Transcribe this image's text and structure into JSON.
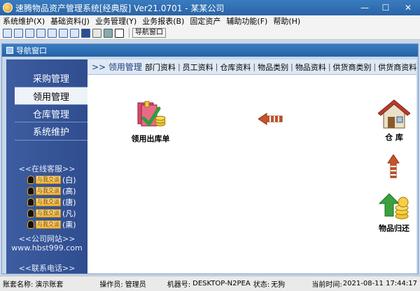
{
  "window": {
    "title": "速腾物品资产管理系统[经典版] Ver21.0701  -  某某公司",
    "minimize": "—",
    "maximize": "☐",
    "close": "✕"
  },
  "menu": [
    "系统维护(X)",
    "基础资料(J)",
    "业务管理(Y)",
    "业务报表(B)",
    "固定资产",
    "辅助功能(F)",
    "帮助(H)"
  ],
  "toolbar": {
    "icons": [
      "window-icon",
      "list-icon",
      "table-icon",
      "folder-open-icon",
      "tree-icon",
      "card-icon",
      "database-icon",
      "save-icon",
      "print-icon",
      "calculator-icon",
      "logout-icon"
    ],
    "nav_button": "导航窗口"
  },
  "nav_window": {
    "title": "导航窗口"
  },
  "sidebar": {
    "items": [
      "采购管理",
      "领用管理",
      "仓库管理",
      "系统维护"
    ],
    "active_index": 1,
    "online_service_label": "<<在线客服>>",
    "qq_contacts": [
      {
        "button": "与我交谈",
        "name": "(白)"
      },
      {
        "button": "与我交谈",
        "name": "(高)"
      },
      {
        "button": "与我交谈",
        "name": "(唐)"
      },
      {
        "button": "与我交谈",
        "name": "(凡)"
      },
      {
        "button": "与我交谈",
        "name": "(熏)"
      }
    ],
    "website_label": "<<公司网站>>",
    "website": "www.hbst999.com",
    "phone_label": "<<联系电话>>"
  },
  "main": {
    "section_title": ">> 领用管理",
    "tabs": [
      "部门资料",
      "员工资料",
      "仓库资料",
      "物品类别",
      "物品资料",
      "供货商类别",
      "供货商资料"
    ],
    "nodes": {
      "issue": "领用出库单",
      "warehouse": "仓 库",
      "return": "物品归还"
    }
  },
  "statusbar": {
    "account_label": "账套名称:",
    "account": "演示账套",
    "operator_label": "操作员:",
    "operator": "管理员",
    "machine_label": "机器号:",
    "machine": "DESKTOP-N2PEA",
    "state_label": "状态:",
    "state": "无狗",
    "time_label": "当前时间:",
    "time": "2021-08-11 17:44:17"
  }
}
